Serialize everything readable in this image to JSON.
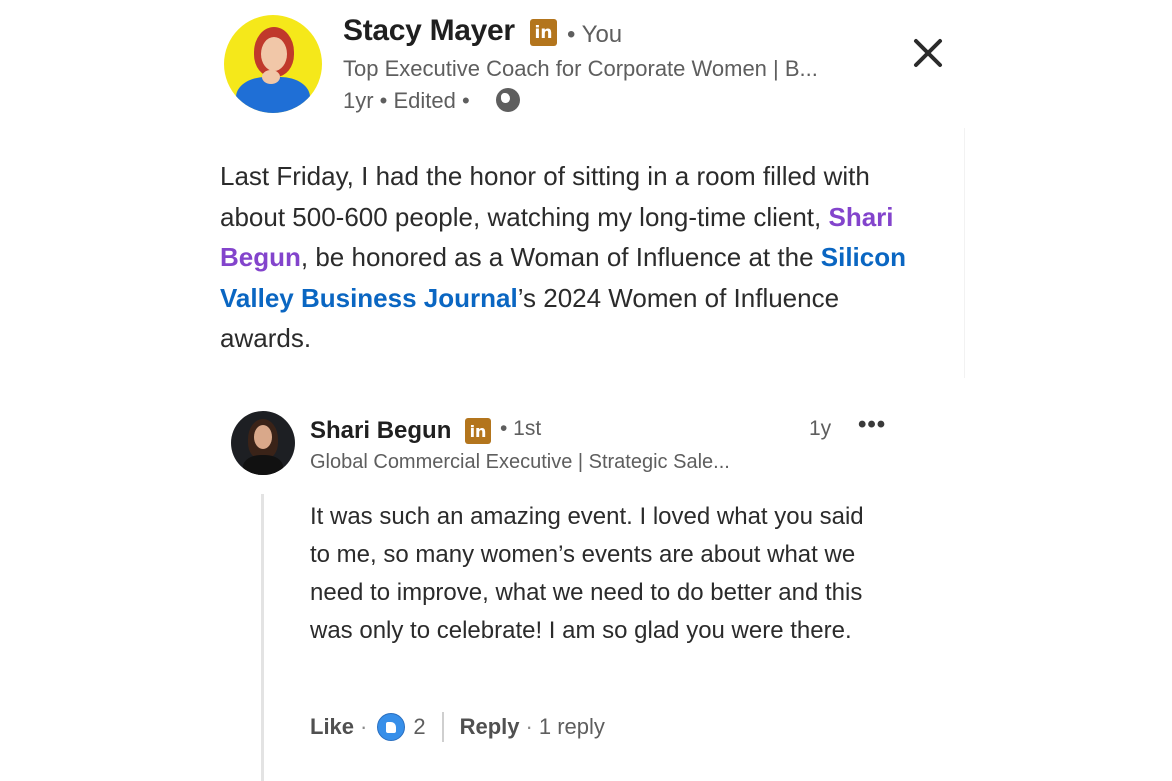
{
  "post": {
    "author": {
      "name": "Stacy Mayer",
      "badge": "in",
      "relation": "• You",
      "headline": "Top Executive Coach for Corporate Women | B...",
      "meta": "1yr • Edited •"
    },
    "body": {
      "text_1": "Last Friday, I had the honor of sitting in a room filled with about 500-600 people, watching my long-time client, ",
      "mention": "Shari Begun",
      "text_2": ", be honored as a Woman of Influence at the ",
      "company": "Silicon Valley Business Journal",
      "text_3": "’s 2024 Women of Influence awards."
    }
  },
  "comment": {
    "author": {
      "name": "Shari Begun",
      "badge": "in",
      "degree": "• 1st",
      "headline": "Global Commercial Executive | Strategic Sale..."
    },
    "time": "1y",
    "more": "•••",
    "body": "It was such an amazing event. I loved what you said to me, so many women’s events are about what we need to improve, what we need to do better and this was only to celebrate! I am so glad you were there.",
    "actions": {
      "like": "Like",
      "like_count": "2",
      "reply": "Reply",
      "reply_count": "1 reply",
      "dot": "·"
    }
  },
  "colors": {
    "mention": "#8344cc",
    "link": "#0a66c2",
    "badge": "#b3751d",
    "like": "#378fe9"
  },
  "icons": [
    "close-icon",
    "globe-icon",
    "linkedin-badge-icon",
    "like-reaction-icon",
    "more-icon"
  ]
}
